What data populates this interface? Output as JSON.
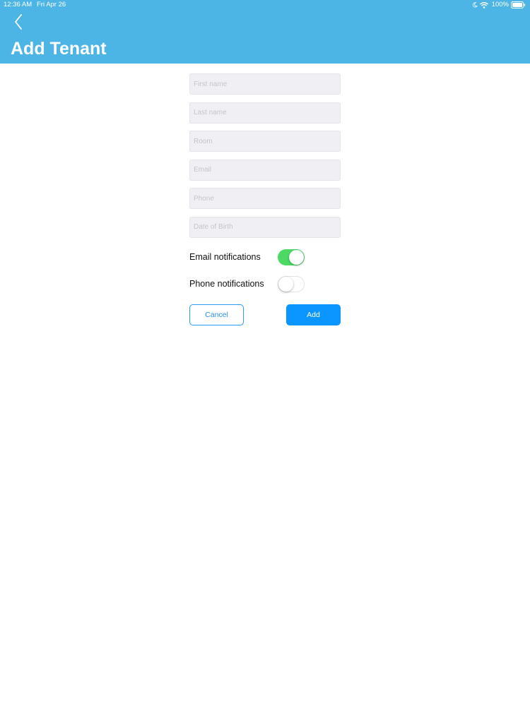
{
  "status_bar": {
    "time": "12:36 AM",
    "date": "Fri Apr 26",
    "battery": "100%"
  },
  "header": {
    "title": "Add Tenant",
    "background_color": "#4db5e6"
  },
  "form": {
    "fields": [
      {
        "placeholder": "First name",
        "value": ""
      },
      {
        "placeholder": "Last name",
        "value": ""
      },
      {
        "placeholder": "Room",
        "value": ""
      },
      {
        "placeholder": "Email",
        "value": ""
      },
      {
        "placeholder": "Phone",
        "value": ""
      },
      {
        "placeholder": "Date of Birth",
        "value": ""
      }
    ],
    "toggles": [
      {
        "label": "Email notifications",
        "on": true
      },
      {
        "label": "Phone notifications",
        "on": false
      }
    ],
    "cancel_label": "Cancel",
    "add_label": "Add",
    "accent_color": "#0a95ff",
    "toggle_on_color": "#4cd964"
  },
  "icons": {
    "back": "chevron-left-icon",
    "moon": "moon-icon",
    "wifi": "wifi-icon",
    "battery": "battery-icon"
  }
}
